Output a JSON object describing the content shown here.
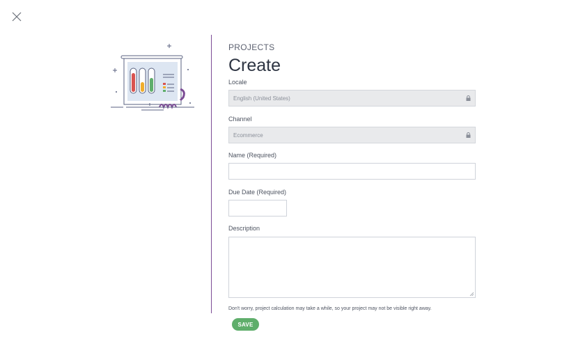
{
  "header": {
    "eyebrow": "PROJECTS",
    "title": "Create"
  },
  "fields": {
    "locale": {
      "label": "Locale",
      "value": "English (United States)",
      "locked": true
    },
    "channel": {
      "label": "Channel",
      "value": "Ecommerce",
      "locked": true
    },
    "name": {
      "label": "Name (Required)",
      "value": ""
    },
    "due_date": {
      "label": "Due Date (Required)",
      "value": ""
    },
    "description": {
      "label": "Description",
      "value": ""
    }
  },
  "note": "Don't worry, project calculation may take a while, so your project may not be visible right away.",
  "actions": {
    "save_label": "SAVE"
  },
  "colors": {
    "accent_divider": "#7b4b94",
    "save_button": "#5fae6b",
    "locked_field_bg": "#e9eaec"
  },
  "icons": [
    "close-icon",
    "lock-icon",
    "presentation-board-illustration",
    "resize-handle-icon"
  ]
}
